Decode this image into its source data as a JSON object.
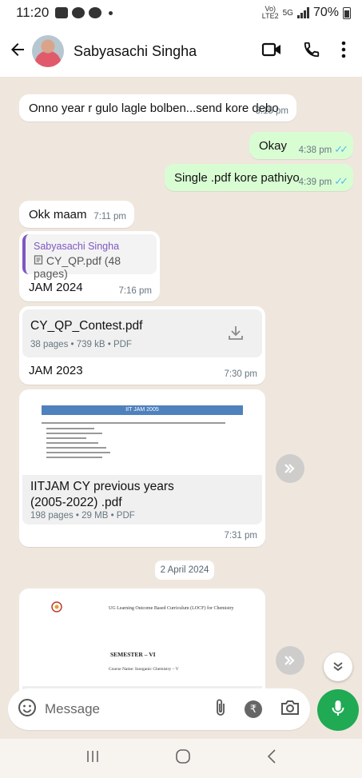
{
  "status_bar": {
    "time": "11:20",
    "signal_top": "Vo)",
    "signal_sub": "LTE2",
    "network": "5G",
    "battery": "70%"
  },
  "header": {
    "contact_name": "Sabyasachi Singha"
  },
  "messages": [
    {
      "direction": "in",
      "text": "Onno year r gulo lagle bolben...send kore debo",
      "time": "3:15 pm"
    },
    {
      "direction": "out",
      "text": "Okay",
      "time": "4:38 pm",
      "ticks": "✓✓"
    },
    {
      "direction": "out",
      "text": "Single .pdf kore pathiyo",
      "time": "4:39 pm",
      "ticks": "✓✓"
    },
    {
      "direction": "in",
      "text": "Okk maam",
      "time": "7:11 pm"
    },
    {
      "direction": "in",
      "quote_name": "Sabyasachi Singha",
      "quote_file": "CY_QP.pdf (48 pages)",
      "text": "JAM 2024",
      "time": "7:16 pm"
    },
    {
      "direction": "in",
      "doc_name": "CY_QP_Contest.pdf",
      "doc_info": "38 pages • 739 kB • PDF",
      "text": "JAM 2023",
      "time": "7:30 pm"
    },
    {
      "direction": "in",
      "preview_band": "IIT JAM 2005",
      "doc_name_line1": "IITJAM CY previous years",
      "doc_name_line2": "(2005-2022) .pdf",
      "doc_info": "198 pages • 29 MB • PDF",
      "time": "7:31 pm"
    }
  ],
  "date_divider": "2 April 2024",
  "last_preview": {
    "heading": "UG Learning Outcome Based Curriculum (LOCF) for Chemistry",
    "semester": "SEMESTER – VI",
    "course": "Course Name: Inorganic Chemistry – V"
  },
  "composer": {
    "placeholder": "Message",
    "rupee_symbol": "₹"
  },
  "colors": {
    "outgoing_bubble": "#d9fdd3",
    "read_ticks": "#53bdeb",
    "mic_button": "#1faa53",
    "quote_accent": "#7e57c2",
    "chat_background": "#efe7de"
  },
  "icons": [
    "arrow-left-icon",
    "video-call-icon",
    "phone-icon",
    "more-vert-icon",
    "download-icon",
    "forward-icon",
    "double-chevron-down-icon",
    "emoji-icon",
    "attach-icon",
    "rupee-icon",
    "camera-icon",
    "mic-icon",
    "recents-icon",
    "home-icon",
    "back-nav-icon"
  ]
}
